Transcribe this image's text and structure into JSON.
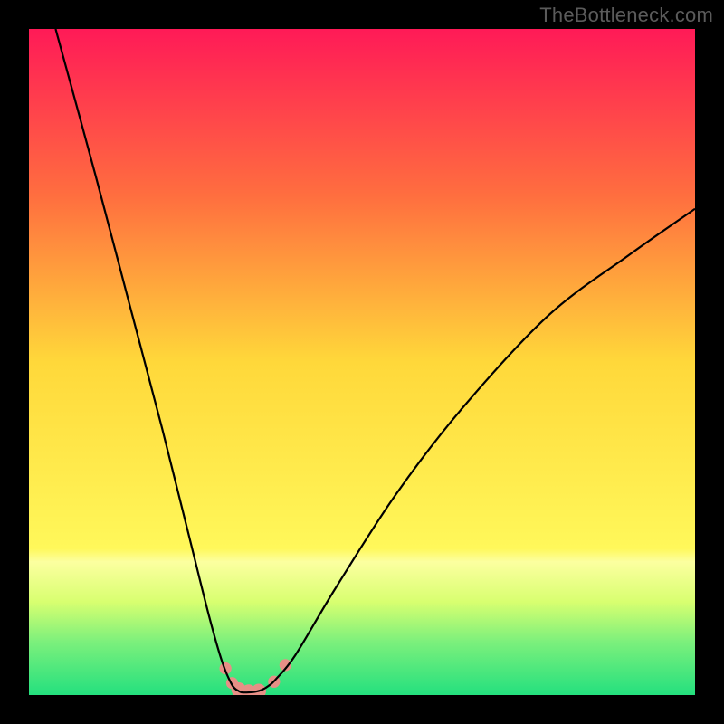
{
  "watermark": "TheBottleneck.com",
  "chart_data": {
    "type": "line",
    "title": "",
    "xlabel": "",
    "ylabel": "",
    "xlim": [
      0,
      100
    ],
    "ylim": [
      0,
      100
    ],
    "background": {
      "type": "vertical-gradient",
      "stops": [
        {
          "pos": 0.0,
          "color": "#ff1a57"
        },
        {
          "pos": 0.25,
          "color": "#ff6e3f"
        },
        {
          "pos": 0.5,
          "color": "#ffd83a"
        },
        {
          "pos": 0.78,
          "color": "#fff85a"
        },
        {
          "pos": 0.8,
          "color": "#fcffa0"
        },
        {
          "pos": 0.86,
          "color": "#d8ff70"
        },
        {
          "pos": 0.92,
          "color": "#7cf07c"
        },
        {
          "pos": 1.0,
          "color": "#24e07e"
        }
      ]
    },
    "series": [
      {
        "name": "bottleneck-curve",
        "color": "#000000",
        "x": [
          4,
          10,
          15,
          20,
          24,
          27,
          29,
          30.5,
          31.5,
          32,
          33,
          34,
          35,
          36,
          37,
          40,
          46,
          55,
          65,
          78,
          90,
          100
        ],
        "y": [
          100,
          78,
          59,
          40,
          24,
          12,
          5,
          1.5,
          0.6,
          0.4,
          0.4,
          0.5,
          0.8,
          1.4,
          2.3,
          6,
          16,
          30,
          43,
          57,
          66,
          73
        ]
      }
    ],
    "highlight": {
      "name": "optimal-region",
      "color": "#e78f86",
      "points": [
        {
          "x": 29.5,
          "y": 4.0,
          "r": 0.9
        },
        {
          "x": 30.5,
          "y": 1.8,
          "r": 0.9
        },
        {
          "x": 31.5,
          "y": 0.8,
          "r": 1.1
        },
        {
          "x": 33.0,
          "y": 0.5,
          "r": 1.1
        },
        {
          "x": 34.5,
          "y": 0.6,
          "r": 1.1
        },
        {
          "x": 36.8,
          "y": 2.0,
          "r": 0.9
        },
        {
          "x": 38.5,
          "y": 4.5,
          "r": 0.9
        }
      ]
    }
  }
}
